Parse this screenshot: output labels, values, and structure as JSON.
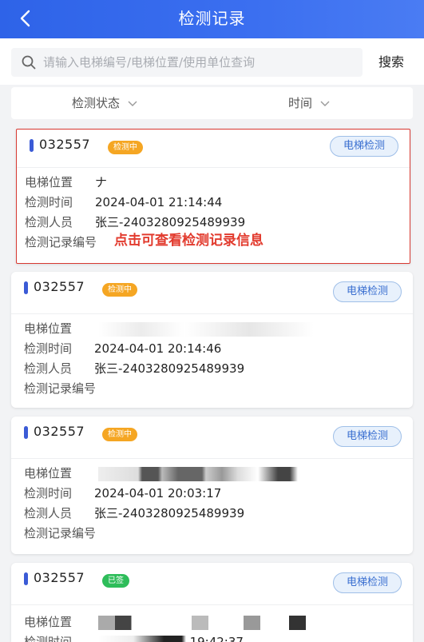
{
  "header": {
    "title": "检测记录"
  },
  "search": {
    "placeholder": "请输入电梯编号/电梯位置/使用单位查询",
    "button": "搜索"
  },
  "filters": [
    {
      "label": "检测状态"
    },
    {
      "label": "时间"
    }
  ],
  "labels": {
    "location": "电梯位置",
    "time": "检测时间",
    "inspector": "检测人员",
    "record_no": "检测记录编号"
  },
  "records": [
    {
      "number": "032557",
      "status": "检测中",
      "status_color": "#f5a623",
      "tag": "电梯检测",
      "location": "ナ",
      "time": "2024-04-01 21:14:44",
      "inspector": "张三-2403280925489939",
      "record_no": "",
      "annotation": "点击可查看检测记录信息"
    },
    {
      "number": "032557",
      "status": "检测中",
      "status_color": "#f5a623",
      "tag": "电梯检测",
      "location": "",
      "time": "2024-04-01 20:14:46",
      "inspector": "张三-2403280925489939",
      "record_no": ""
    },
    {
      "number": "032557",
      "status": "检测中",
      "status_color": "#f5a623",
      "tag": "电梯检测",
      "location": "",
      "time": "2024-04-01 20:03:17",
      "inspector": "张三-2403280925489939",
      "record_no": ""
    },
    {
      "number": "032557",
      "status": "已签",
      "status_color": "#2ebd5a",
      "tag": "电梯检测",
      "location": "",
      "time": "19:42:37"
    }
  ]
}
